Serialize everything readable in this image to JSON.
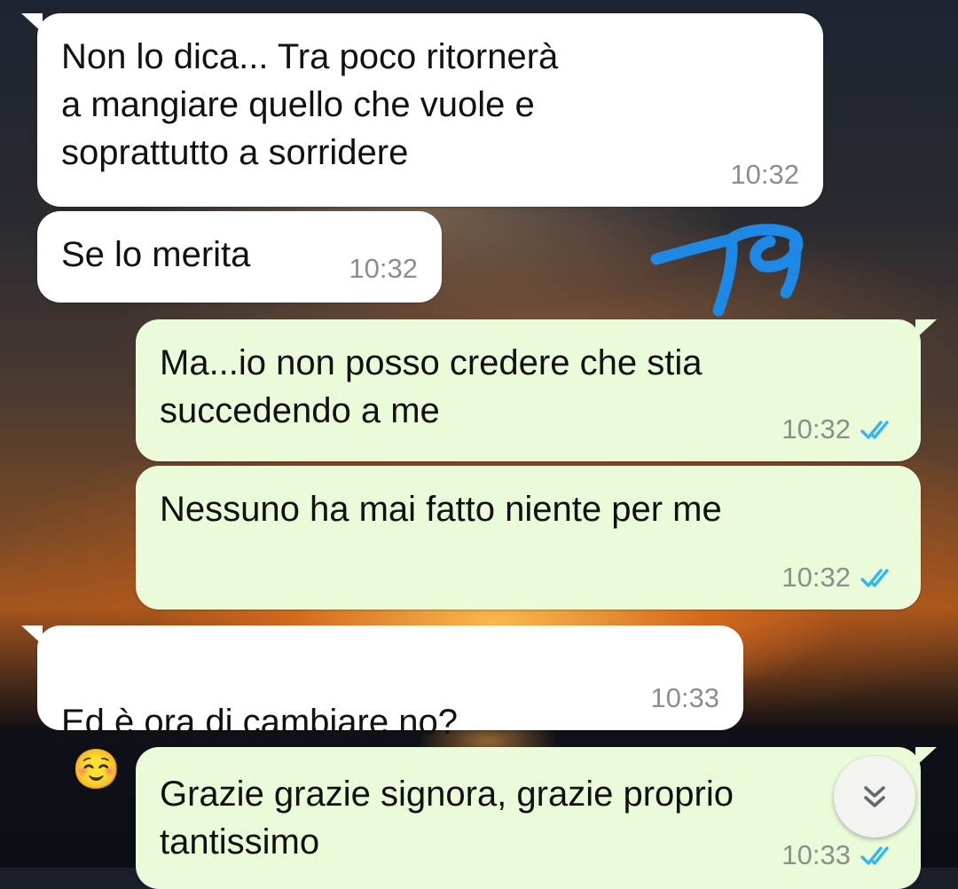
{
  "messages": [
    {
      "direction": "incoming",
      "text": "Non lo dica... Tra poco ritornerà\na mangiare quello che vuole e\nsoprattutto a sorridere",
      "time": "10:32"
    },
    {
      "direction": "incoming",
      "text": "Se lo merita",
      "time": "10:32"
    },
    {
      "direction": "outgoing",
      "text": "Ma...io non posso credere che stia\nsuccedendo a me",
      "time": "10:32",
      "status": "read"
    },
    {
      "direction": "outgoing",
      "text": "Nessuno ha mai fatto niente per me",
      "time": "10:32",
      "status": "read"
    },
    {
      "direction": "incoming",
      "text": "Ed è ora di cambiare no?",
      "emoji": "☺️",
      "time": "10:33"
    },
    {
      "direction": "outgoing",
      "text": "Grazie grazie signora, grazie proprio\ntantissimo",
      "time": "10:33",
      "status": "read"
    }
  ],
  "icons": {
    "read_receipt": "double-check-icon",
    "scroll_down": "double-chevron-down-icon",
    "emoji": "smiling-face-icon",
    "annotation": "blue-pen-scribble"
  },
  "colors": {
    "incoming_bubble": "#ffffff",
    "outgoing_bubble": "#e9fbd9",
    "read_tick": "#34b7f1",
    "timestamp": "#8a8f8a",
    "scribble": "#1e88e5"
  }
}
